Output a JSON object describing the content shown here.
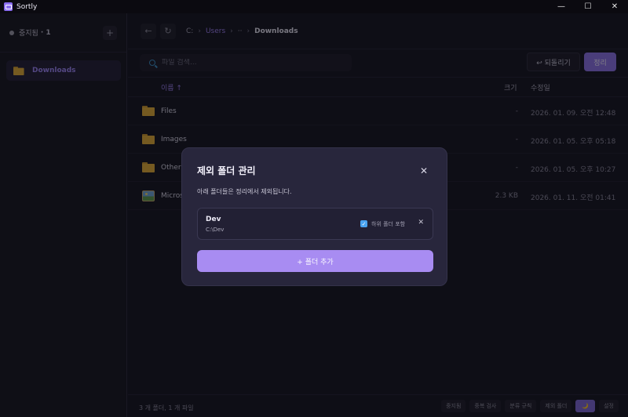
{
  "app": {
    "title": "Sortly"
  },
  "window_controls": {
    "minimize": "—",
    "maximize": "☐",
    "close": "✕"
  },
  "sidebar": {
    "status_label": "중지됨",
    "status_count": "· 1",
    "add_label": "+",
    "items": [
      {
        "label": "Downloads"
      }
    ]
  },
  "path": {
    "back": "←",
    "refresh": "↻",
    "crumbs": [
      "C:",
      "Users",
      "··",
      "Downloads"
    ],
    "separator": "›"
  },
  "toolbar": {
    "search_placeholder": "파일 검색...",
    "undo_label": "↩ 되돌리기",
    "sort_label": "정리"
  },
  "table": {
    "headers": {
      "name": "이름 ↑",
      "size": "크기",
      "date": "수정일"
    },
    "rows": [
      {
        "name": "Files",
        "size": "-",
        "date": "2026. 01. 09. 오전 12:48",
        "icon": "folder-icon"
      },
      {
        "name": "Images",
        "size": "-",
        "date": "2026. 01. 05. 오후 05:18",
        "icon": "folder-icon"
      },
      {
        "name": "Others",
        "size": "-",
        "date": "2026. 01. 05. 오후 10:27",
        "icon": "folder-icon"
      },
      {
        "name": "Micros",
        "size": "2.3 KB",
        "date": "2026. 01. 11. 오전 01:41",
        "icon": "image-icon"
      }
    ]
  },
  "statusbar": {
    "text": "3 개 폴더, 1 개 파일",
    "buttons": [
      "중지됨",
      "중복 검사",
      "분류 규칙",
      "제외 폴더",
      "🌙",
      "설정"
    ]
  },
  "modal": {
    "title": "제외 폴더 관리",
    "close": "✕",
    "description": "아래 폴더들은 정리에서 제외됩니다.",
    "folders": [
      {
        "name": "Dev",
        "path": "C:\\Dev",
        "include_subfolders_label": "하위 폴더 포함",
        "include_subfolders": true,
        "remove": "✕"
      }
    ],
    "add_label": "+ 폴더 추가"
  },
  "colors": {
    "accent": "#a88cf2",
    "background": "#15141f",
    "modal": "#28263c",
    "folder": "#e3ad35"
  }
}
